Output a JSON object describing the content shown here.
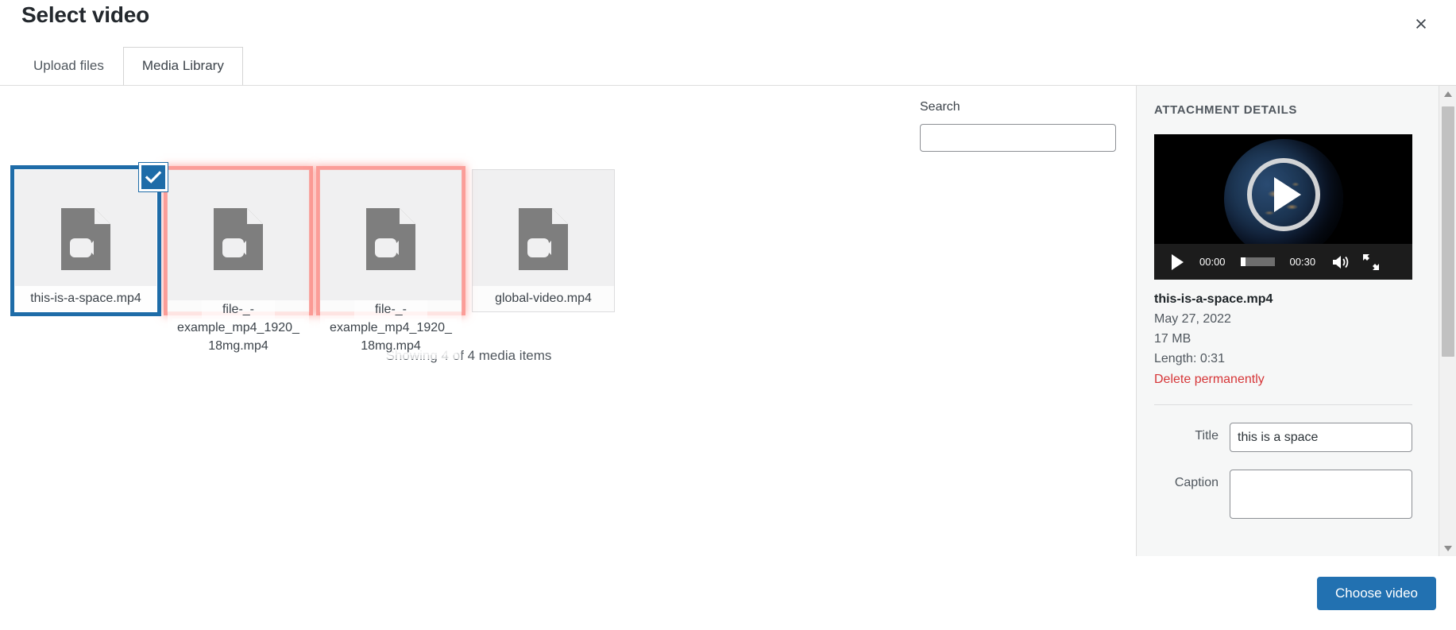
{
  "modal": {
    "title": "Select video",
    "close_icon": "close-icon"
  },
  "tabs": [
    {
      "label": "Upload files",
      "active": false
    },
    {
      "label": "Media Library",
      "active": true
    }
  ],
  "search": {
    "label": "Search",
    "value": "",
    "placeholder": ""
  },
  "attachments": [
    {
      "filename": "this-is-a-space.mp4",
      "state": "selected",
      "icon": "video-file-icon",
      "checked": true
    },
    {
      "filename": "file-_-example_mp4_1920_18mg.mp4",
      "filename_lines": [
        "file-_-",
        "example_mp4_1920_",
        "18mg.mp4"
      ],
      "state": "flagged",
      "icon": "video-file-icon",
      "checked": false
    },
    {
      "filename": "file-_-example_mp4_1920_18mg.mp4",
      "filename_lines": [
        "file-_-",
        "example_mp4_1920_",
        "18mg.mp4"
      ],
      "state": "flagged",
      "icon": "video-file-icon",
      "checked": false
    },
    {
      "filename": "global-video.mp4",
      "state": "normal",
      "icon": "video-file-icon",
      "checked": false
    }
  ],
  "media_count_text": "Showing 4 of 4 media items",
  "sidebar": {
    "heading": "ATTACHMENT DETAILS",
    "player": {
      "current_time": "00:00",
      "duration": "00:30",
      "play_icon": "play-icon",
      "volume_icon": "volume-icon",
      "fullscreen_icon": "fullscreen-icon",
      "poster_description": "earth-from-space-poster"
    },
    "meta": {
      "filename": "this-is-a-space.mp4",
      "date": "May 27, 2022",
      "filesize": "17 MB",
      "length": "Length: 0:31",
      "delete_label": "Delete permanently"
    },
    "fields": {
      "title_label": "Title",
      "title_value": "this is a space",
      "caption_label": "Caption",
      "caption_value": ""
    }
  },
  "footer": {
    "choose_label": "Choose video"
  },
  "colors": {
    "accent_blue": "#2271b1",
    "selected_blue": "#1e6ca8",
    "delete_red": "#d63638",
    "flag_pink": "#fb9d98"
  }
}
